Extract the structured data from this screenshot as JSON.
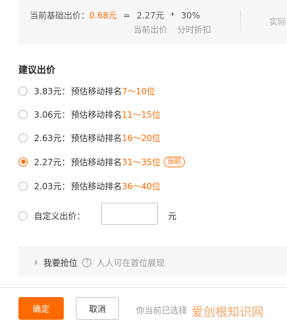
{
  "info": {
    "base_label": "当前基础出价：",
    "base_value": "0.68元",
    "eq": "=",
    "current_price": "2.27元",
    "times": "*",
    "discount": "30%",
    "current_price_label": "当前出价",
    "discount_label": "分时折扣",
    "right_cut": "实际"
  },
  "section_title": "建议出价",
  "options": [
    {
      "price": "3.83元：",
      "desc": "预估移动排名",
      "rank": "7～10位",
      "selected": false,
      "badge": ""
    },
    {
      "price": "3.06元：",
      "desc": "预估移动排名",
      "rank": "11～15位",
      "selected": false,
      "badge": ""
    },
    {
      "price": "2.63元：",
      "desc": "预估移动排名",
      "rank": "16～20位",
      "selected": false,
      "badge": ""
    },
    {
      "price": "2.27元：",
      "desc": "预估移动排名",
      "rank": "31～35位",
      "selected": true,
      "badge": "当前"
    },
    {
      "price": "2.03元：",
      "desc": "预估移动排名",
      "rank": "36～40位",
      "selected": false,
      "badge": ""
    }
  ],
  "custom": {
    "label": "自定义出价：",
    "value": "",
    "unit": "元"
  },
  "grab": {
    "label": "我要抢位",
    "help": "?",
    "desc": "人人可在首位展现"
  },
  "footer": {
    "ok": "确定",
    "cancel": "取消",
    "note": "你当前已选择"
  },
  "watermark": "爱创根知识网",
  "colors": {
    "accent": "#ff6a00"
  }
}
